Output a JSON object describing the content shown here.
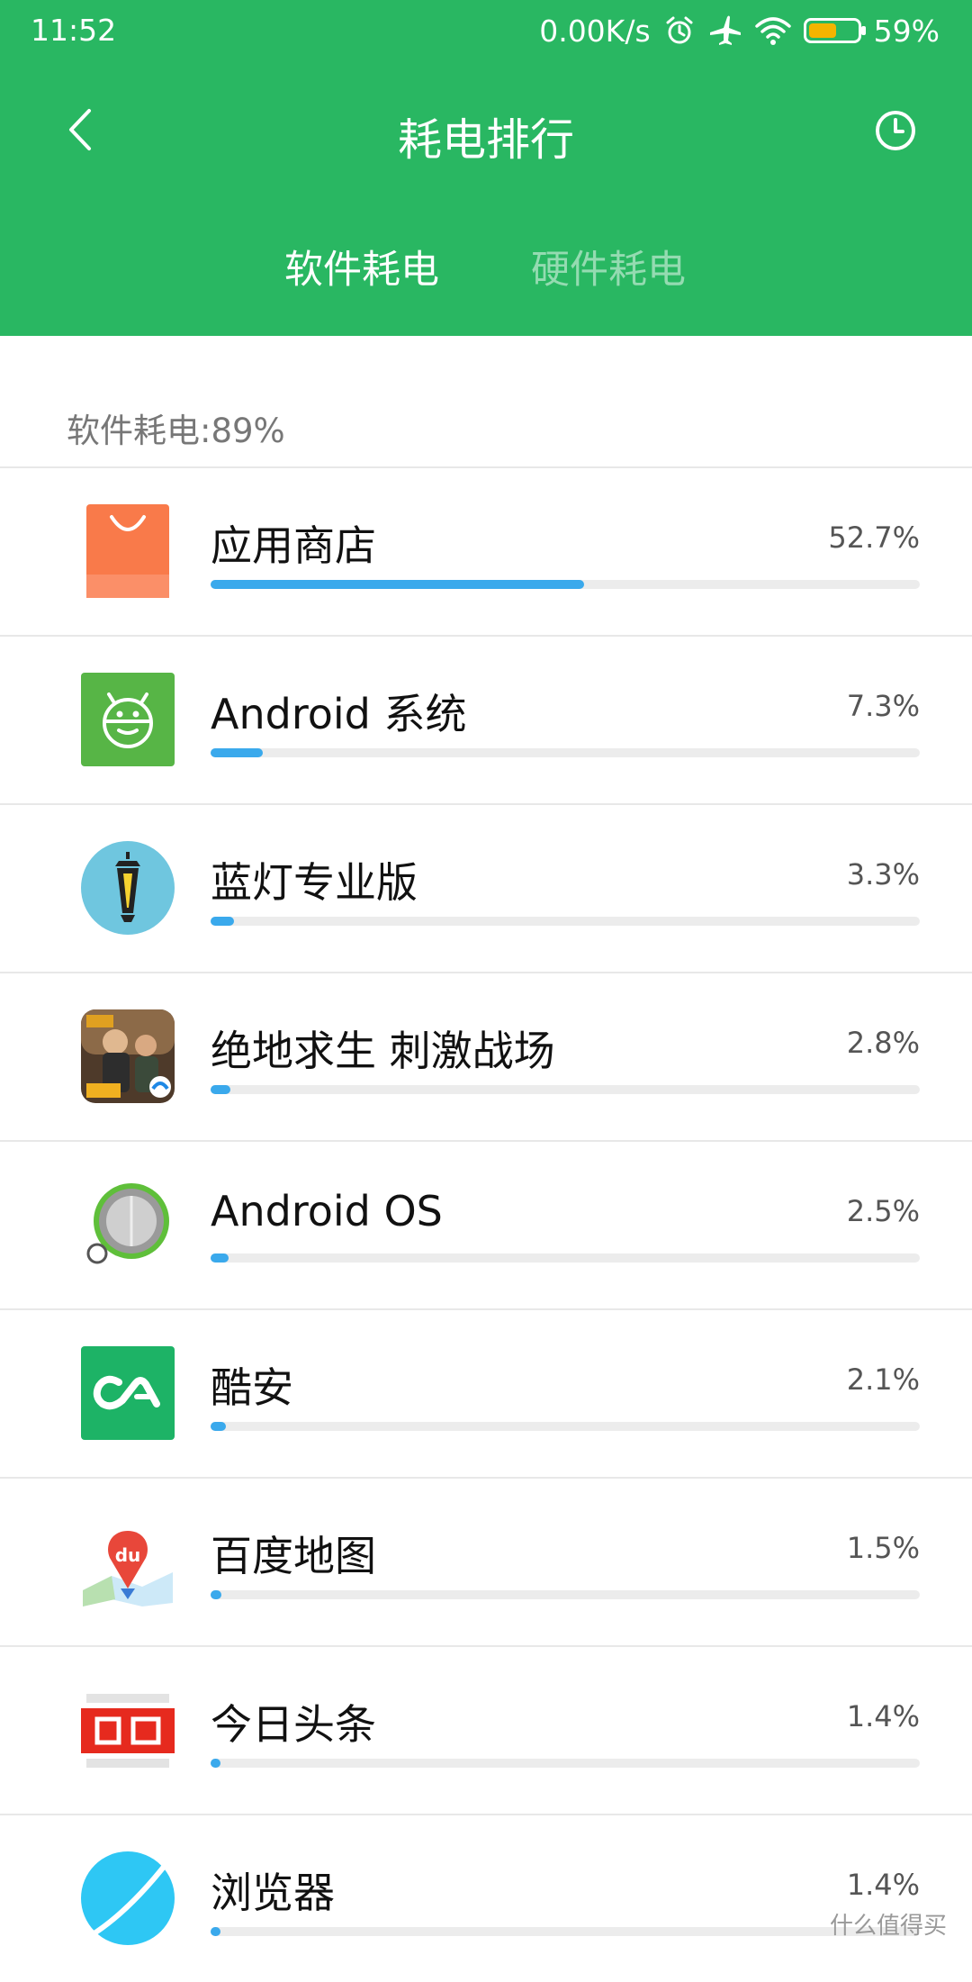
{
  "status_bar": {
    "time": "11:52",
    "net_speed": "0.00K/s",
    "battery_percent": "59%",
    "battery_level": 0.59,
    "icons": [
      "alarm-icon",
      "airplane-mode-icon",
      "wifi-icon",
      "battery-icon"
    ]
  },
  "header": {
    "title": "耗电排行",
    "back_icon": "back-chevron-icon",
    "history_icon": "clock-history-icon",
    "color": "#29b762"
  },
  "tabs": [
    {
      "label": "软件耗电",
      "active": true
    },
    {
      "label": "硬件耗电",
      "active": false
    }
  ],
  "section": {
    "label": "软件耗电:89%"
  },
  "apps": [
    {
      "name": "应用商店",
      "percent": "52.7%",
      "fraction": 0.527,
      "icon": "app-store-bag-icon"
    },
    {
      "name": "Android 系统",
      "percent": "7.3%",
      "fraction": 0.073,
      "icon": "android-robot-icon"
    },
    {
      "name": "蓝灯专业版",
      "percent": "3.3%",
      "fraction": 0.033,
      "icon": "lantern-icon"
    },
    {
      "name": "绝地求生 刺激战场",
      "percent": "2.8%",
      "fraction": 0.028,
      "icon": "pubg-game-icon"
    },
    {
      "name": "Android OS",
      "percent": "2.5%",
      "fraction": 0.025,
      "icon": "android-os-orb-icon"
    },
    {
      "name": "酷安",
      "percent": "2.1%",
      "fraction": 0.021,
      "icon": "coolapk-icon"
    },
    {
      "name": "百度地图",
      "percent": "1.5%",
      "fraction": 0.015,
      "icon": "baidu-map-pin-icon"
    },
    {
      "name": "今日头条",
      "percent": "1.4%",
      "fraction": 0.014,
      "icon": "toutiao-icon"
    },
    {
      "name": "浏览器",
      "percent": "1.4%",
      "fraction": 0.014,
      "icon": "browser-planet-icon"
    }
  ],
  "accent_color": "#3aa9ec",
  "watermark": "什么值得买"
}
